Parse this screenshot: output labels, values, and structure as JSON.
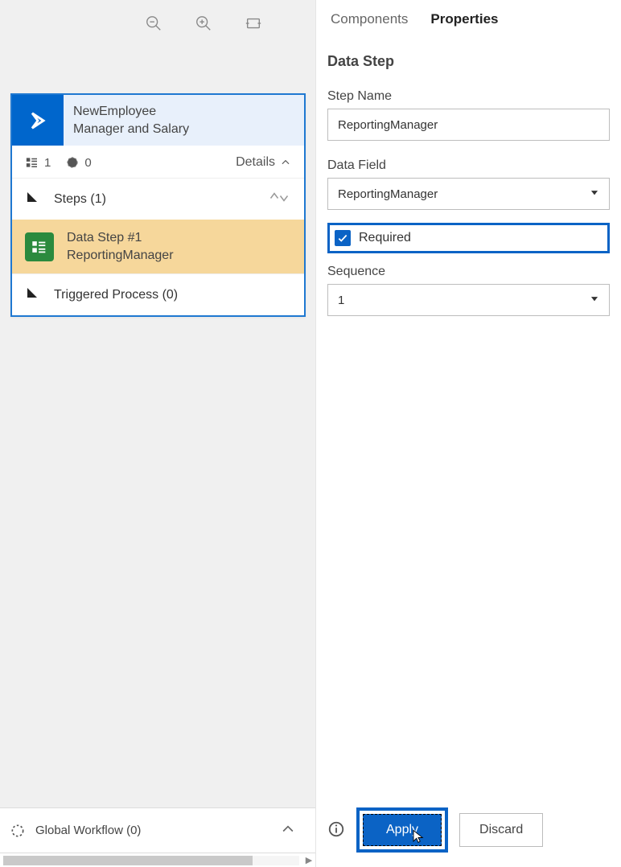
{
  "canvas": {
    "stage": {
      "title_line1": "NewEmployee",
      "title_line2": "Manager and Salary",
      "meta_count1": "1",
      "meta_count2": "0",
      "details_label": "Details",
      "steps_label": "Steps (1)",
      "data_step_line1": "Data Step #1",
      "data_step_line2": "ReportingManager",
      "triggered_label": "Triggered Process (0)"
    },
    "global_workflow": "Global Workflow (0)"
  },
  "panel": {
    "tabs": {
      "components": "Components",
      "properties": "Properties"
    },
    "subtitle": "Data Step",
    "step_name_label": "Step Name",
    "step_name_value": "ReportingManager",
    "data_field_label": "Data Field",
    "data_field_value": "ReportingManager",
    "required_label": "Required",
    "sequence_label": "Sequence",
    "sequence_value": "1",
    "apply": "Apply",
    "discard": "Discard"
  }
}
